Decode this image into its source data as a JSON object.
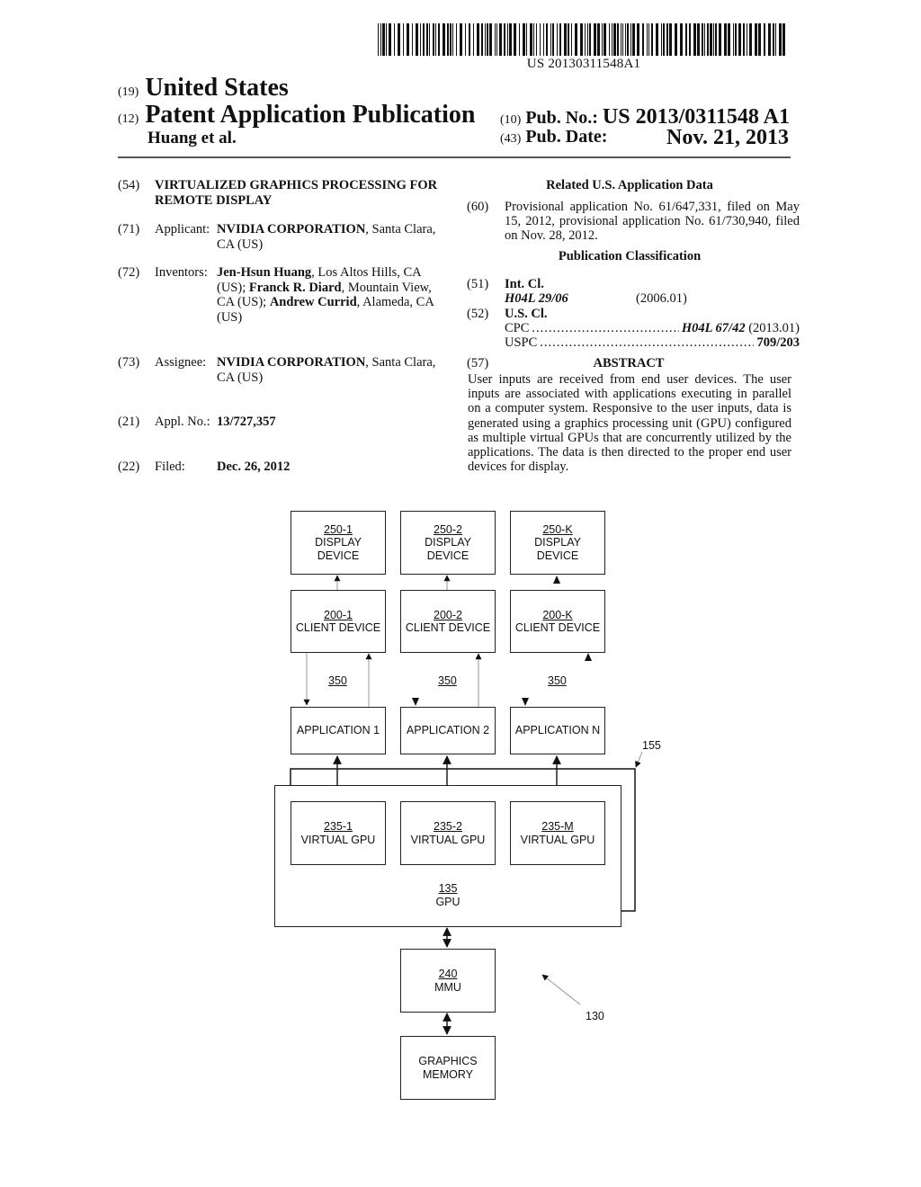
{
  "header": {
    "barcode_text": "US 20130311548A1",
    "country_code": "(19)",
    "country": "United States",
    "type_code": "(12)",
    "type": "Patent Application Publication",
    "authors": "Huang et al.",
    "pub_no_code": "(10)",
    "pub_no_label": "Pub. No.:",
    "pub_no": "US 2013/0311548 A1",
    "pub_date_code": "(43)",
    "pub_date_label": "Pub. Date:",
    "pub_date": "Nov. 21, 2013"
  },
  "left": {
    "title_code": "(54)",
    "title": "VIRTUALIZED GRAPHICS PROCESSING FOR REMOTE DISPLAY",
    "applicant": {
      "code": "(71)",
      "label": "Applicant:",
      "name": "NVIDIA CORPORATION",
      "location": ", Santa Clara, CA (US)"
    },
    "inventors": {
      "code": "(72)",
      "label": "Inventors:",
      "list": [
        {
          "name": "Jen-Hsun Huang",
          "location": ", Los Altos Hills, CA (US); "
        },
        {
          "name": "Franck R. Diard",
          "location": ", Mountain View, CA (US); "
        },
        {
          "name": "Andrew Currid",
          "location": ", Alameda, CA (US)"
        }
      ]
    },
    "assignee": {
      "code": "(73)",
      "label": "Assignee:",
      "name": "NVIDIA CORPORATION",
      "location": ", Santa Clara, CA (US)"
    },
    "appl_no": {
      "code": "(21)",
      "label": "Appl. No.:",
      "value": "13/727,357"
    },
    "filed": {
      "code": "(22)",
      "label": "Filed:",
      "value": "Dec. 26, 2012"
    }
  },
  "right": {
    "related_heading": "Related U.S. Application Data",
    "provisional": {
      "code": "(60)",
      "text": "Provisional application No. 61/647,331, filed on May 15, 2012, provisional application No. 61/730,940, filed on Nov. 28, 2012."
    },
    "classification_heading": "Publication Classification",
    "int_cl": {
      "code": "(51)",
      "label": "Int. Cl.",
      "class": "H04L 29/06",
      "version": "(2006.01)"
    },
    "us_cl": {
      "code": "(52)",
      "label": "U.S. Cl.",
      "cpc_label": "CPC",
      "cpc_class": "H04L 67/42",
      "cpc_version": "(2013.01)",
      "uspc_label": "USPC",
      "uspc_class": "709/203"
    },
    "abstract_code": "(57)",
    "abstract_heading": "ABSTRACT",
    "abstract": "User inputs are received from end user devices. The user inputs are associated with applications executing in parallel on a computer system. Responsive to the user inputs, data is generated using a graphics processing unit (GPU) configured as multiple virtual GPUs that are concurrently utilized by the applications. The data is then directed to the proper end user devices for display."
  },
  "figure": {
    "display_devices": [
      {
        "ref": "250-1",
        "line1": "DISPLAY",
        "line2": "DEVICE"
      },
      {
        "ref": "250-2",
        "line1": "DISPLAY",
        "line2": "DEVICE"
      },
      {
        "ref": "250-K",
        "line1": "DISPLAY",
        "line2": "DEVICE"
      }
    ],
    "client_devices": [
      {
        "ref": "200-1",
        "label": "CLIENT DEVICE"
      },
      {
        "ref": "200-2",
        "label": "CLIENT DEVICE"
      },
      {
        "ref": "200-K",
        "label": "CLIENT DEVICE"
      }
    ],
    "links": [
      "350",
      "350",
      "350"
    ],
    "applications": [
      "APPLICATION 1",
      "APPLICATION 2",
      "APPLICATION N"
    ],
    "virtual_gpus": [
      {
        "ref": "235-1",
        "label": "VIRTUAL GPU"
      },
      {
        "ref": "235-2",
        "label": "VIRTUAL GPU"
      },
      {
        "ref": "235-M",
        "label": "VIRTUAL GPU"
      }
    ],
    "gpu": {
      "ref": "135",
      "label": "GPU"
    },
    "gpu_stack_ref": "155",
    "mmu": {
      "ref": "240",
      "label": "MMU"
    },
    "graphics_memory": {
      "line1": "GRAPHICS",
      "line2": "MEMORY"
    },
    "system_ref": "130"
  }
}
